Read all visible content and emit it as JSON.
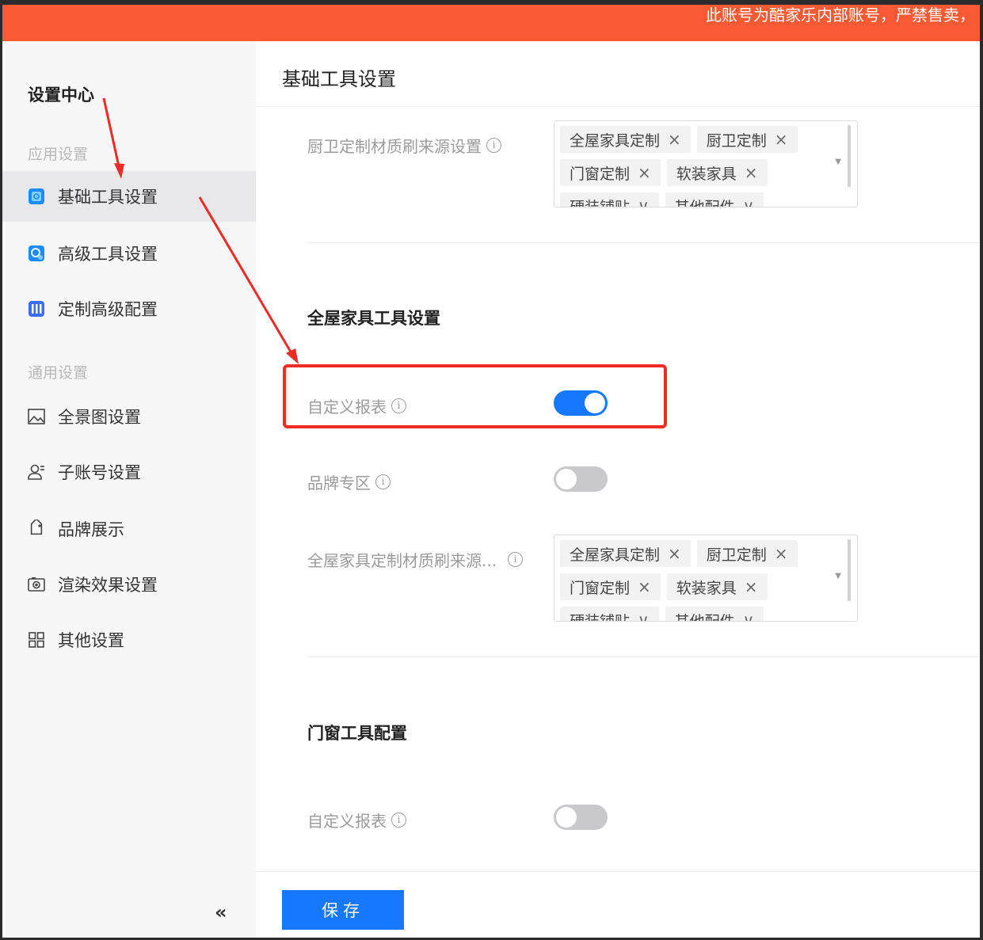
{
  "banner": {
    "text": "此账号为酷家乐内部账号，严禁售卖，"
  },
  "sidebar": {
    "title": "设置中心",
    "groups": [
      {
        "label": "应用设置",
        "items": [
          {
            "label": "基础工具设置",
            "icon": "basic-tool-icon",
            "active": true
          },
          {
            "label": "高级工具设置",
            "icon": "advanced-tool-icon"
          },
          {
            "label": "定制高级配置",
            "icon": "custom-config-icon"
          }
        ]
      },
      {
        "label": "通用设置",
        "items": [
          {
            "label": "全景图设置",
            "icon": "image-icon"
          },
          {
            "label": "子账号设置",
            "icon": "user-icon"
          },
          {
            "label": "品牌展示",
            "icon": "tag-icon"
          },
          {
            "label": "渲染效果设置",
            "icon": "camera-icon"
          },
          {
            "label": "其他设置",
            "icon": "grid-icon"
          }
        ]
      }
    ],
    "collapse_label": "«"
  },
  "main": {
    "title": "基础工具设置",
    "kitchen_source": {
      "label": "厨卫定制材质刷来源设置",
      "tags": [
        "全屋家具定制",
        "厨卫定制",
        "门窗定制",
        "软装家具",
        "硬装铺贴",
        "其他配件"
      ]
    },
    "whole_house": {
      "title": "全屋家具工具设置",
      "custom_report": {
        "label": "自定义报表",
        "on": true
      },
      "brand_zone": {
        "label": "品牌专区",
        "on": false
      },
      "material_source": {
        "label": "全屋家具定制材质刷来源...",
        "tags": [
          "全屋家具定制",
          "厨卫定制",
          "门窗定制",
          "软装家具",
          "硬装铺贴",
          "其他配件"
        ]
      }
    },
    "door_window": {
      "title": "门窗工具配置",
      "custom_report": {
        "label": "自定义报表",
        "on": false
      }
    },
    "save_label": "保存",
    "info_glyph": "i",
    "tag_close_glyph": "×",
    "tag_more_glyph": "∨",
    "caret_glyph": "▼"
  },
  "colors": {
    "banner": "#fa5a33",
    "primary": "#1677ff",
    "annotation": "#ee2b24",
    "sidebar_bg": "#f7f7f8",
    "sidebar_active": "#e8e8ea"
  }
}
